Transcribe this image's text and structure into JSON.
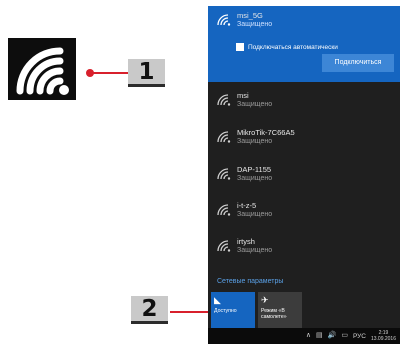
{
  "callouts": [
    {
      "label": "1"
    },
    {
      "label": "2"
    }
  ],
  "icons": {
    "wifi_callout": "wifi-icon",
    "network": "wifi-icon"
  },
  "flyout": {
    "active_network": {
      "name": "msi_5G",
      "status": "Защищено",
      "auto_connect_label": "Подключаться автоматически",
      "connect_button": "Подключиться"
    },
    "networks": [
      {
        "name": "msi",
        "status": "Защищено"
      },
      {
        "name": "MikroTik-7C66A5",
        "status": "Защищено"
      },
      {
        "name": "DAP-1155",
        "status": "Защищено"
      },
      {
        "name": "i-t-z-5",
        "status": "Защищено"
      },
      {
        "name": "irtysh",
        "status": "Защищено"
      }
    ],
    "settings_link": "Сетевые параметры",
    "tiles": [
      {
        "label": "Доступно"
      },
      {
        "label": "Режим «В самолете»"
      }
    ]
  },
  "taskbar": {
    "language": "РУС",
    "time": "2:19",
    "date": "13.09.2016"
  },
  "colors": {
    "accent": "#1565c0",
    "callout": "#d8202c",
    "flyout_bg": "#1f1f1f"
  }
}
